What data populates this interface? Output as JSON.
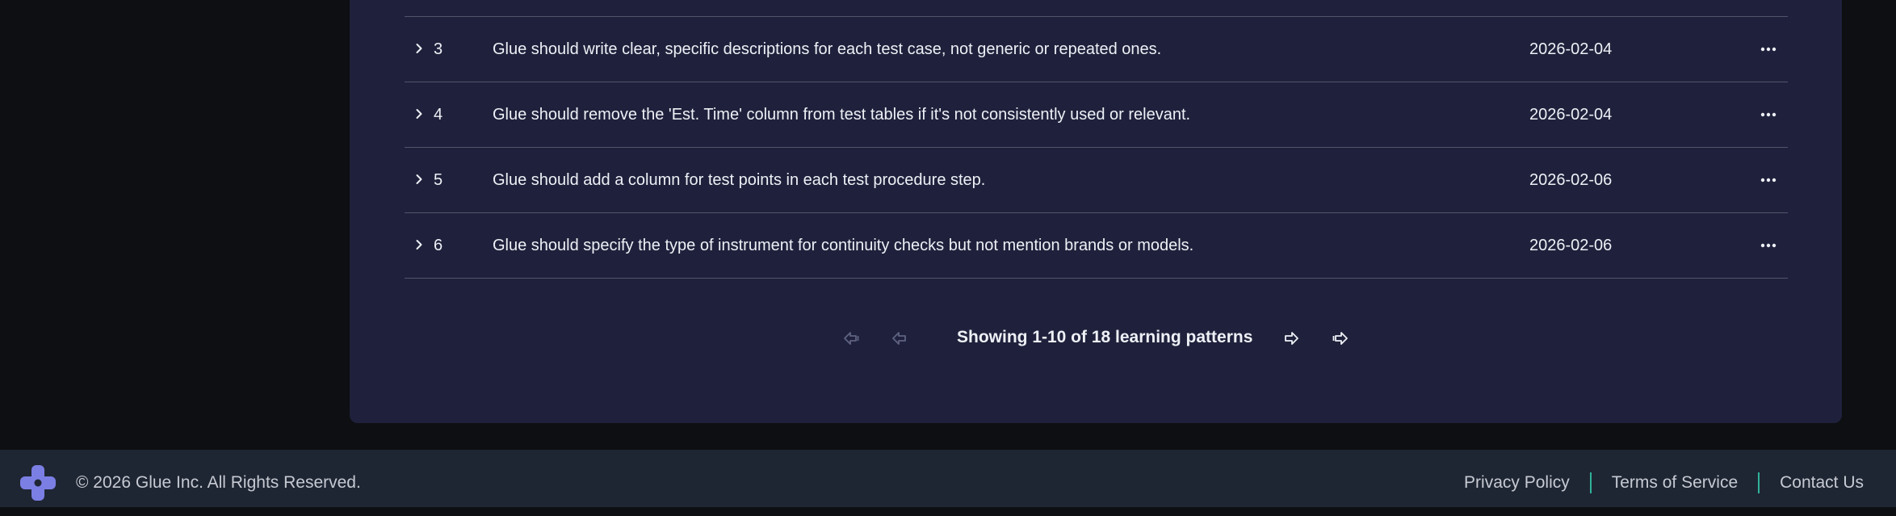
{
  "rows": [
    {
      "num": "3",
      "description": "Glue should write clear, specific descriptions for each test case, not generic or repeated ones.",
      "date": "2026-02-04"
    },
    {
      "num": "4",
      "description": "Glue should remove the 'Est. Time' column from test tables if it's not consistently used or relevant.",
      "date": "2026-02-04"
    },
    {
      "num": "5",
      "description": "Glue should add a column for test points in each test procedure step.",
      "date": "2026-02-06"
    },
    {
      "num": "6",
      "description": "Glue should specify the type of instrument for continuity checks but not mention brands or models.",
      "date": "2026-02-06"
    }
  ],
  "pagination": {
    "status": "Showing 1-10 of 18 learning patterns",
    "first_icon": "first-page-icon",
    "prev_icon": "previous-page-icon",
    "next_icon": "next-page-icon",
    "last_icon": "last-page-icon",
    "first_disabled": true,
    "prev_disabled": true
  },
  "footer": {
    "copyright": "© 2026 Glue Inc. All Rights Reserved.",
    "links": [
      "Privacy Policy",
      "Terms of Service",
      "Contact Us"
    ],
    "logo_icon": "glue-logo-icon"
  },
  "colors": {
    "background": "#0e0f12",
    "panel": "#1f213c",
    "footer": "#1f2633",
    "logo": "#7b7fe4",
    "link_separator": "#2fb39a",
    "row_divider": "#51546a"
  }
}
